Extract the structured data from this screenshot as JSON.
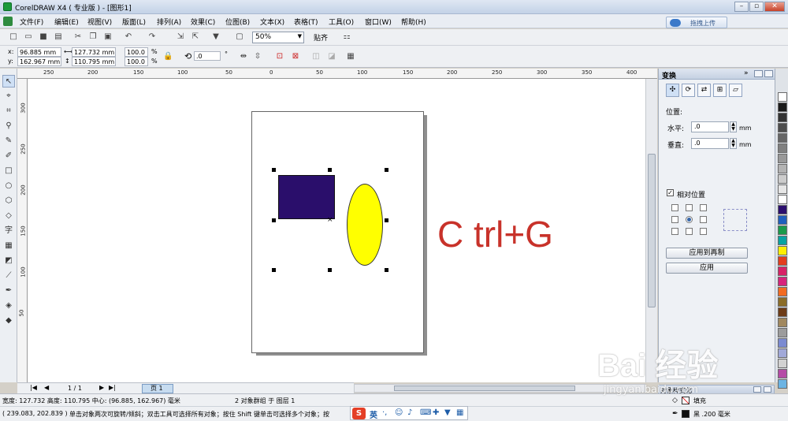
{
  "window": {
    "title": "CorelDRAW X4 ( 专业版 ) - [图形1]",
    "min_label": "–",
    "max_label": "▫",
    "close_label": "✕"
  },
  "menubar": {
    "items": [
      "文件(F)",
      "编辑(E)",
      "视图(V)",
      "版面(L)",
      "排列(A)",
      "效果(C)",
      "位图(B)",
      "文本(X)",
      "表格(T)",
      "工具(O)",
      "窗口(W)",
      "帮助(H)"
    ],
    "upload_label": "拖拽上传"
  },
  "toolbar": {
    "zoom_value": "50%",
    "snap_label": "贴齐"
  },
  "propbar": {
    "x_label": "x:",
    "x_value": "96.885 mm",
    "y_label": "y:",
    "y_value": "162.967 mm",
    "w_value": "127.732 mm",
    "h_value": "110.795 mm",
    "scale_x": "100.0",
    "scale_y": "100.0",
    "percent": "%",
    "rotation": ".0",
    "degree": "°"
  },
  "ruler": {
    "top_ticks": [
      "250",
      "200",
      "150",
      "100",
      "50",
      "0",
      "50",
      "100",
      "150",
      "200",
      "250",
      "300",
      "350",
      "400"
    ],
    "left_ticks": [
      "300",
      "250",
      "200",
      "150",
      "100",
      "50"
    ]
  },
  "canvas": {
    "hint_text": "C trl+G",
    "rect_color": "#2a0e6b",
    "ellipse_color": "#ffff00",
    "hint_color": "#c8322a"
  },
  "pagenav": {
    "counter": "1 / 1",
    "page_tab": "页 1"
  },
  "docker": {
    "title": "变换",
    "position_label": "位置:",
    "h_label": "水平:",
    "h_value": ".0",
    "h_unit": "mm",
    "v_label": "垂直:",
    "v_value": ".0",
    "v_unit": "mm",
    "relative_label": "相对位置",
    "apply_copy_label": "应用到再制",
    "apply_label": "应用"
  },
  "palette": {
    "colors": [
      "#ffffff",
      "#1a1a1a",
      "#333333",
      "#4d4d4d",
      "#666666",
      "#808080",
      "#999999",
      "#b3b3b3",
      "#cccccc",
      "#e6e6e6",
      "#ffffff",
      "#2b0f6e",
      "#1f5fbd",
      "#1a9a4b",
      "#08a3a3",
      "#ffee00",
      "#e33d1e",
      "#d72267",
      "#d7247c",
      "#f26b22",
      "#8b6d28",
      "#6d3c18",
      "#a1885f",
      "#9c9c9c",
      "#7b8bd2",
      "#a1a9d9",
      "#d2d2d2",
      "#b54ca7",
      "#6cb4e3"
    ]
  },
  "status": {
    "line1_left": "宽度: 127.732 高度: 110.795 中心: (96.885, 162.967) 毫米",
    "line1_mid": "2 对象群组 于 图层 1",
    "line2_coords": "( 239.083, 202.839 )",
    "line2_hint": "单击对象两次可旋转/倾斜；双击工具可选择所有对象；按住 Shift 键单击可选择多个对象；按",
    "fill_label": "填充",
    "outline_label": "黑  .200 毫米",
    "style_title": "对象样式化"
  },
  "ime": {
    "logo": "S",
    "lang": "英"
  },
  "watermark": {
    "text": "Bai 经验",
    "url": "jingyan.baidu.com"
  }
}
